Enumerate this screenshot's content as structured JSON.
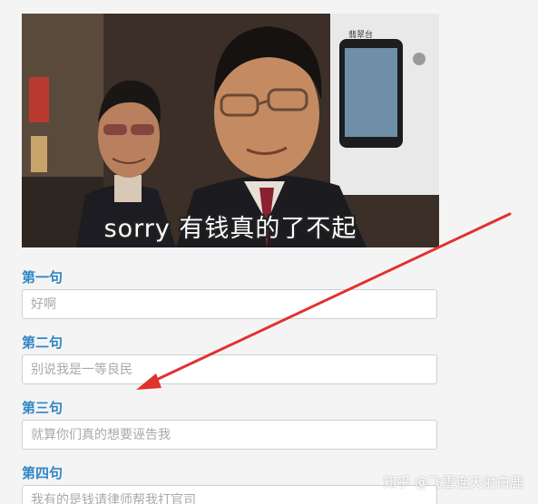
{
  "meme": {
    "caption": "sorry 有钱真的了不起",
    "tv_logo_text": "翡翠台"
  },
  "fields": [
    {
      "label": "第一句",
      "placeholder": "好啊"
    },
    {
      "label": "第二句",
      "placeholder": "别说我是一等良民"
    },
    {
      "label": "第三句",
      "placeholder": "就算你们真的想要诬告我"
    },
    {
      "label": "第四句",
      "placeholder": "我有的是钱请律师帮我打官司"
    }
  ],
  "annotation": {
    "color": "#e0322f"
  },
  "watermark": {
    "text": "知乎 @飞雪连天射白鹿"
  },
  "colors": {
    "label": "#2f86c5",
    "background": "#f4f4f4",
    "input_border": "#cfcfcf"
  }
}
